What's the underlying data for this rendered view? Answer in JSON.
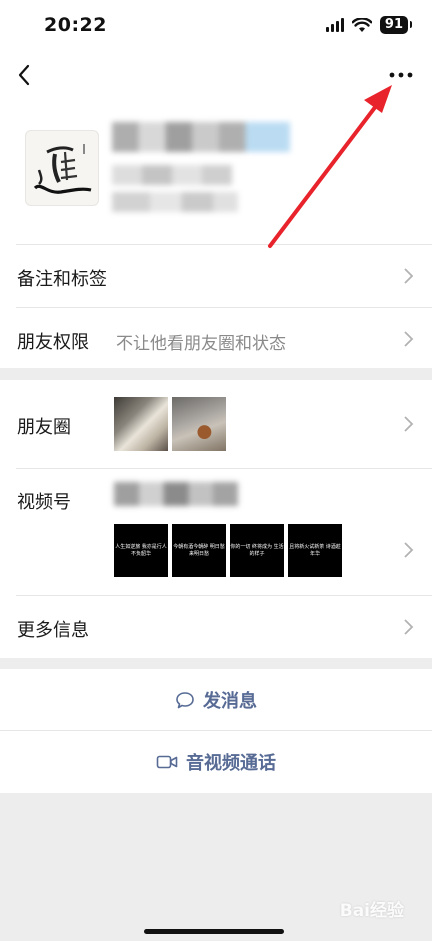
{
  "status_bar": {
    "time": "20:22",
    "battery": "91"
  },
  "rows": {
    "remark_label": "备注和标签",
    "permission_label": "朋友权限",
    "permission_value": "不让他看朋友圈和状态",
    "moments_label": "朋友圈",
    "channels_label": "视频号",
    "more_info_label": "更多信息"
  },
  "actions": {
    "send_message": "发消息",
    "av_call": "音视频通话"
  },
  "video_thumbs": [
    "人生如逆旅 我亦是行人 不负韶华",
    "今朝有酒今朝醉 明日愁来明日愁",
    "你的一切 终将成为 生活的样子",
    "且将新火试新茶 诗酒趁年华"
  ],
  "watermark": "Bai经验",
  "colors": {
    "link_blue": "#576b95",
    "arrow_red": "#e8232b",
    "background": "#ededed"
  },
  "icons": {
    "back": "chevron-left-icon",
    "more": "more-dots-icon",
    "row_arrow": "chevron-right-icon",
    "message": "chat-bubble-icon",
    "video": "video-camera-icon"
  }
}
